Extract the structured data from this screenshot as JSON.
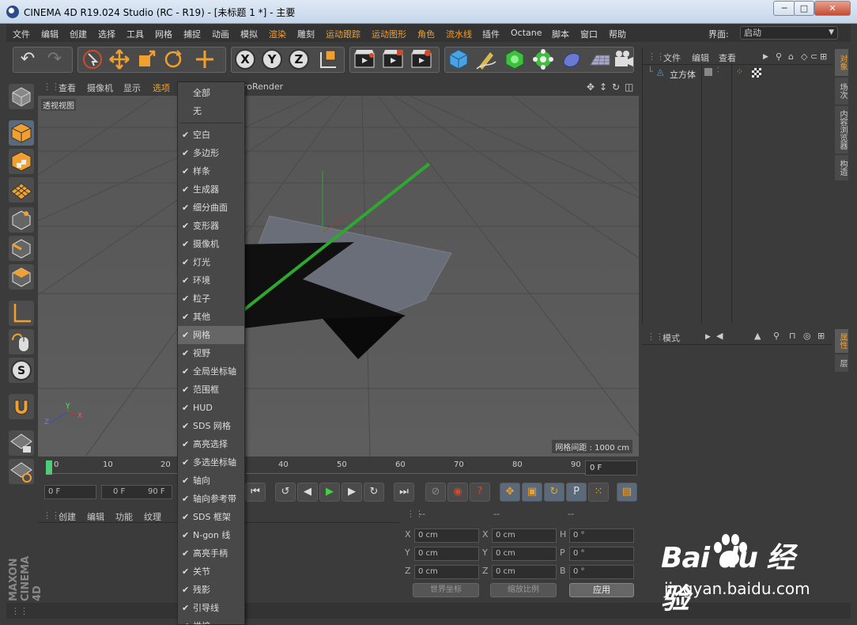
{
  "window": {
    "title": "CINEMA 4D R19.024 Studio (RC - R19) - [未标题 1 *] - 主要",
    "min_label": "─",
    "max_label": "□",
    "close_label": "✕"
  },
  "menubar": {
    "items": [
      "文件",
      "编辑",
      "创建",
      "选择",
      "工具",
      "网格",
      "捕捉",
      "动画",
      "模拟",
      "渲染",
      "雕刻",
      "运动跟踪",
      "运动图形",
      "角色",
      "流水线",
      "插件",
      "Octane",
      "脚本",
      "窗口",
      "帮助"
    ],
    "layout_label": "界面:",
    "layout_value": "启动"
  },
  "viewport": {
    "menu": [
      "查看",
      "摄像机",
      "显示",
      "选项"
    ],
    "renderer_label": "roRender",
    "view_name": "透视视图",
    "grid_spacing": "网格间距 : 1000 cm",
    "axis_y": "Y",
    "axis_x": "X",
    "axis_z": "Z"
  },
  "filter_menu": {
    "items": [
      {
        "label": "全部",
        "checked": false
      },
      {
        "label": "无",
        "checked": false
      },
      {
        "label": "空白",
        "checked": true
      },
      {
        "label": "多边形",
        "checked": true
      },
      {
        "label": "样条",
        "checked": true
      },
      {
        "label": "生成器",
        "checked": true
      },
      {
        "label": "细分曲面",
        "checked": true
      },
      {
        "label": "变形器",
        "checked": true
      },
      {
        "label": "摄像机",
        "checked": true
      },
      {
        "label": "灯光",
        "checked": true
      },
      {
        "label": "环境",
        "checked": true
      },
      {
        "label": "粒子",
        "checked": true
      },
      {
        "label": "其他",
        "checked": true
      },
      {
        "label": "网格",
        "checked": true,
        "highlighted": true
      },
      {
        "label": "视野",
        "checked": true
      },
      {
        "label": "全局坐标轴",
        "checked": true
      },
      {
        "label": "范围框",
        "checked": true
      },
      {
        "label": "HUD",
        "checked": true
      },
      {
        "label": "SDS 网格",
        "checked": true
      },
      {
        "label": "高亮选择",
        "checked": true
      },
      {
        "label": "多选坐标轴",
        "checked": true
      },
      {
        "label": "轴向",
        "checked": true
      },
      {
        "label": "轴向参考带",
        "checked": true
      },
      {
        "label": "SDS 框架",
        "checked": true
      },
      {
        "label": "N-gon 线",
        "checked": true
      },
      {
        "label": "高亮手柄",
        "checked": true
      },
      {
        "label": "关节",
        "checked": true
      },
      {
        "label": "残影",
        "checked": true
      },
      {
        "label": "引导线",
        "checked": true
      },
      {
        "label": "烘焙",
        "checked": true
      }
    ]
  },
  "timeline": {
    "ticks": [
      "0",
      "10",
      "20",
      "40",
      "50",
      "60",
      "70",
      "80",
      "90"
    ],
    "current_frame": "0 F",
    "start_field": "0 F",
    "range_start": "0 F",
    "range_end": "90 F"
  },
  "material_manager": {
    "menu": [
      "创建",
      "编辑",
      "功能",
      "纹理"
    ]
  },
  "coordinates": {
    "headers": [
      "--",
      "--",
      "--"
    ],
    "rows": [
      {
        "a": "X",
        "av": "0 cm",
        "b": "X",
        "bv": "0 cm",
        "c": "H",
        "cv": "0 °"
      },
      {
        "a": "Y",
        "av": "0 cm",
        "b": "Y",
        "bv": "0 cm",
        "c": "P",
        "cv": "0 °"
      },
      {
        "a": "Z",
        "av": "0 cm",
        "b": "Z",
        "bv": "0 cm",
        "c": "B",
        "cv": "0 °"
      }
    ],
    "space_dropdown": "世界坐标",
    "scale_dropdown": "缩放比例",
    "apply_label": "应用"
  },
  "object_manager": {
    "menu": [
      "文件",
      "编辑",
      "查看"
    ],
    "object_name": "立方体"
  },
  "attribute_manager": {
    "menu": [
      "模式"
    ]
  },
  "side_tabs": [
    "对象",
    "场次",
    "内容浏览器",
    "构造"
  ],
  "side_tabs_lower": [
    "属性",
    "层"
  ],
  "brand": {
    "vertical_logo": "MAXON CINEMA 4D"
  },
  "watermark": {
    "brand": "Bai du 经验",
    "url": "jingyan.baidu.com"
  },
  "colors": {
    "accent_orange": "#f0a030",
    "arrow_green": "#2ea82e",
    "viewport_bg": "#5a5a5a"
  }
}
